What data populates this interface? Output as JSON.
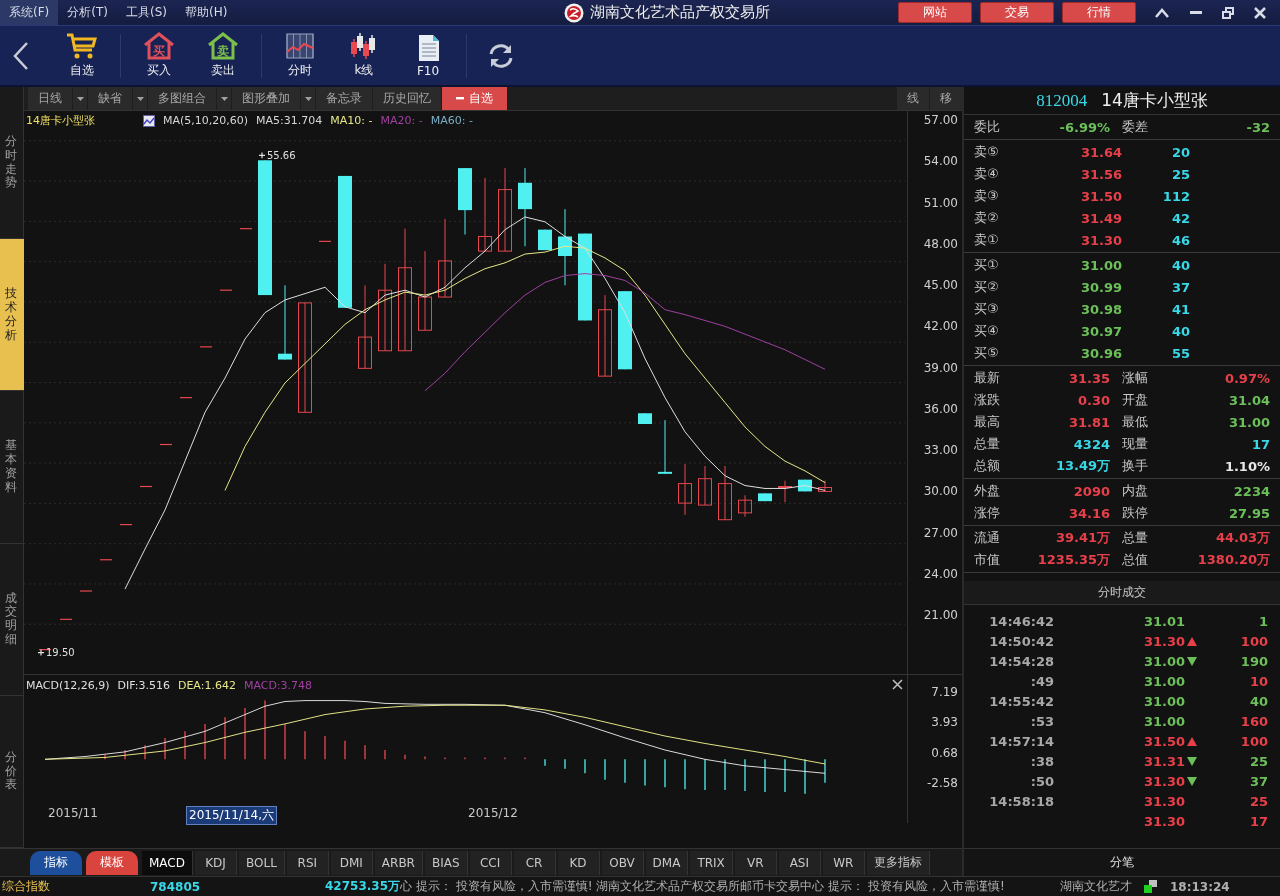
{
  "menu": [
    {
      "label": "系统(F)",
      "selected": true
    },
    {
      "label": "分析(T)",
      "selected": false
    },
    {
      "label": "工具(S)",
      "selected": false
    },
    {
      "label": "帮助(H)",
      "selected": false
    }
  ],
  "app_title": "湖南文化艺术品产权交易所",
  "header_buttons": [
    "网站",
    "交易",
    "行情"
  ],
  "toolbar": [
    {
      "label": "自选",
      "kind": "cart"
    },
    {
      "label": "买入",
      "kind": "house",
      "icon_text": "买",
      "color": "#e0505a"
    },
    {
      "label": "卖出",
      "kind": "house",
      "icon_text": "卖",
      "color": "#7cc04a"
    },
    {
      "label": "分时",
      "kind": "grid"
    },
    {
      "label": "k线",
      "kind": "candles"
    },
    {
      "label": "F10",
      "kind": "doc"
    }
  ],
  "side_tabs": [
    {
      "label": "分时走势",
      "selected": false
    },
    {
      "label": "技术分析",
      "selected": true
    },
    {
      "label": "基本资料",
      "selected": false
    },
    {
      "label": "成交明细",
      "selected": false
    },
    {
      "label": "分价表",
      "selected": false
    }
  ],
  "chart_toolbar": [
    {
      "label": "日线",
      "kind": "dropdown"
    },
    {
      "label": "缺省",
      "kind": "dropdown"
    },
    {
      "label": "多图组合",
      "kind": "dropdown"
    },
    {
      "label": "图形叠加",
      "kind": "dropdown"
    },
    {
      "label": "备忘录",
      "kind": "plain"
    },
    {
      "label": "历史回忆",
      "kind": "plain"
    },
    {
      "label": "自选",
      "kind": "remove"
    }
  ],
  "chart_tools": [
    "线",
    "移"
  ],
  "legend": {
    "symbol": "14唐卡小型张",
    "ma": "MA(5,10,20,60)",
    "items": [
      {
        "text": "MA5:31.704",
        "color": "#d8d8d8"
      },
      {
        "text": "MA10: -",
        "color": "#e8e88a"
      },
      {
        "text": "MA20: -",
        "color": "#a040a0"
      },
      {
        "text": "MA60: -",
        "color": "#7ab0c8"
      }
    ]
  },
  "price_axis": [
    "57.00",
    "54.00",
    "51.00",
    "48.00",
    "45.00",
    "42.00",
    "39.00",
    "36.00",
    "33.00",
    "30.00",
    "27.00",
    "24.00",
    "21.00"
  ],
  "high_marker": "55.66",
  "low_marker": "19.50",
  "macd": {
    "legend": [
      {
        "text": "MACD(12,26,9)",
        "color": "#e0e0e0"
      },
      {
        "text": "DIF:3.516",
        "color": "#e0e0e0"
      },
      {
        "text": "DEA:1.642",
        "color": "#e8e88a"
      },
      {
        "text": "MACD:3.748",
        "color": "#a040a0"
      }
    ],
    "axis": [
      "7.19",
      "3.93",
      "0.68",
      "-2.58"
    ]
  },
  "dates": [
    {
      "text": "2015/11",
      "kind": "tick"
    },
    {
      "text": "2015/11/14,六",
      "kind": "cursor"
    },
    {
      "text": "2015/12",
      "kind": "tick"
    }
  ],
  "bottom_groups": [
    {
      "label": "指标",
      "color": "#1e4f9c"
    },
    {
      "label": "模板",
      "color": "#d9453e"
    }
  ],
  "indicators": [
    {
      "label": "MACD",
      "selected": true
    },
    {
      "label": "KDJ",
      "selected": false
    },
    {
      "label": "BOLL",
      "selected": false
    },
    {
      "label": "RSI",
      "selected": false
    },
    {
      "label": "DMI",
      "selected": false
    },
    {
      "label": "ARBR",
      "selected": false
    },
    {
      "label": "BIAS",
      "selected": false
    },
    {
      "label": "CCI",
      "selected": false
    },
    {
      "label": "CR",
      "selected": false
    },
    {
      "label": "KD",
      "selected": false
    },
    {
      "label": "OBV",
      "selected": false
    },
    {
      "label": "DMA",
      "selected": false
    },
    {
      "label": "TRIX",
      "selected": false
    },
    {
      "label": "VR",
      "selected": false
    },
    {
      "label": "ASI",
      "selected": false
    },
    {
      "label": "WR",
      "selected": false
    },
    {
      "label": "更多指标",
      "selected": false
    }
  ],
  "quote": {
    "code": "812004",
    "name": "14唐卡小型张",
    "summary": [
      {
        "label": "委比",
        "value": "-6.99%",
        "color": "#6cc05a"
      },
      {
        "label": "委差",
        "value": "-32",
        "color": "#6cc05a"
      }
    ],
    "asks": [
      {
        "label": "卖⑤",
        "price": "31.64",
        "volume": "20",
        "color": "#e8404a"
      },
      {
        "label": "卖④",
        "price": "31.56",
        "volume": "25",
        "color": "#e8404a"
      },
      {
        "label": "卖③",
        "price": "31.50",
        "volume": "112",
        "color": "#e8404a"
      },
      {
        "label": "卖②",
        "price": "31.49",
        "volume": "42",
        "color": "#e8404a"
      },
      {
        "label": "卖①",
        "price": "31.30",
        "volume": "46",
        "color": "#e8404a"
      }
    ],
    "bids": [
      {
        "label": "买①",
        "price": "31.00",
        "volume": "40",
        "color": "#6cc05a"
      },
      {
        "label": "买②",
        "price": "30.99",
        "volume": "37",
        "color": "#6cc05a"
      },
      {
        "label": "买③",
        "price": "30.98",
        "volume": "41",
        "color": "#6cc05a"
      },
      {
        "label": "买④",
        "price": "30.97",
        "volume": "40",
        "color": "#6cc05a"
      },
      {
        "label": "买⑤",
        "price": "30.96",
        "volume": "55",
        "color": "#6cc05a"
      }
    ],
    "stat_groups": [
      [
        {
          "label": "最新",
          "value": "31.35",
          "color": "#e8404a"
        },
        {
          "label": "涨幅",
          "value": "0.97%",
          "color": "#e8404a"
        },
        {
          "label": "涨跌",
          "value": "0.30",
          "color": "#e8404a"
        },
        {
          "label": "开盘",
          "value": "31.04",
          "color": "#6cc05a"
        },
        {
          "label": "最高",
          "value": "31.81",
          "color": "#e8404a"
        },
        {
          "label": "最低",
          "value": "31.00",
          "color": "#6cc05a"
        },
        {
          "label": "总量",
          "value": "4324",
          "color": "#38d8e8"
        },
        {
          "label": "现量",
          "value": "17",
          "color": "#38d8e8"
        },
        {
          "label": "总额",
          "value": "13.49万",
          "color": "#38d8e8"
        },
        {
          "label": "换手",
          "value": "1.10%",
          "color": "#e8e8e8"
        }
      ],
      [
        {
          "label": "外盘",
          "value": "2090",
          "color": "#e8404a"
        },
        {
          "label": "内盘",
          "value": "2234",
          "color": "#6cc05a"
        },
        {
          "label": "涨停",
          "value": "34.16",
          "color": "#e8404a"
        },
        {
          "label": "跌停",
          "value": "27.95",
          "color": "#6cc05a"
        }
      ],
      [
        {
          "label": "流通",
          "value": "39.41万",
          "color": "#e8404a"
        },
        {
          "label": "总量",
          "value": "44.03万",
          "color": "#e8404a"
        },
        {
          "label": "市值",
          "value": "1235.35万",
          "color": "#e8404a"
        },
        {
          "label": "总值",
          "value": "1380.20万",
          "color": "#e8404a"
        }
      ]
    ]
  },
  "trades": {
    "title": "分时成交",
    "footer": "分笔",
    "rows": [
      {
        "time": "14:46:42",
        "price": "31.01",
        "color": "#6cc05a",
        "kind": "plain",
        "volume": {
          "text": "1",
          "color": "#6cc05a"
        }
      },
      {
        "time": "14:50:42",
        "price": "31.30",
        "color": "#e8404a",
        "kind": "up",
        "volume": {
          "text": "100",
          "color": "#e8404a"
        }
      },
      {
        "time": "14:54:28",
        "price": "31.00",
        "color": "#6cc05a",
        "kind": "down",
        "volume": {
          "text": "190",
          "color": "#6cc05a"
        }
      },
      {
        "time": ":49",
        "price": "31.00",
        "color": "#6cc05a",
        "kind": "plain",
        "volume": {
          "text": "10",
          "color": "#e8404a"
        }
      },
      {
        "time": "14:55:42",
        "price": "31.00",
        "color": "#6cc05a",
        "kind": "plain",
        "volume": {
          "text": "40",
          "color": "#6cc05a"
        }
      },
      {
        "time": ":53",
        "price": "31.00",
        "color": "#6cc05a",
        "kind": "plain",
        "volume": {
          "text": "160",
          "color": "#e8404a"
        }
      },
      {
        "time": "14:57:14",
        "price": "31.50",
        "color": "#e8404a",
        "kind": "up",
        "volume": {
          "text": "100",
          "color": "#e8404a"
        }
      },
      {
        "time": ":38",
        "price": "31.31",
        "color": "#e8404a",
        "kind": "down",
        "volume": {
          "text": "25",
          "color": "#6cc05a"
        }
      },
      {
        "time": ":50",
        "price": "31.30",
        "color": "#e8404a",
        "kind": "down",
        "volume": {
          "text": "37",
          "color": "#6cc05a"
        }
      },
      {
        "time": "14:58:18",
        "price": "31.30",
        "color": "#e8404a",
        "kind": "plain",
        "volume": {
          "text": "25",
          "color": "#e8404a"
        }
      },
      {
        "price": "31.30",
        "color": "#e8404a",
        "kind": "plain",
        "volume": {
          "text": "17",
          "color": "#e8404a"
        }
      }
    ]
  },
  "status_bar": {
    "index_label": "综合指数",
    "index_value": "784805",
    "amount": "42753.35万",
    "ticker": "心  提示：  投资有风险，入市需谨慎!      湖南文化艺术品产权交易所邮币卡交易中心  提示：  投资有风险，入市需谨慎!",
    "ticker_tail": "湖南文化艺才",
    "clock": "18:13:24"
  }
}
